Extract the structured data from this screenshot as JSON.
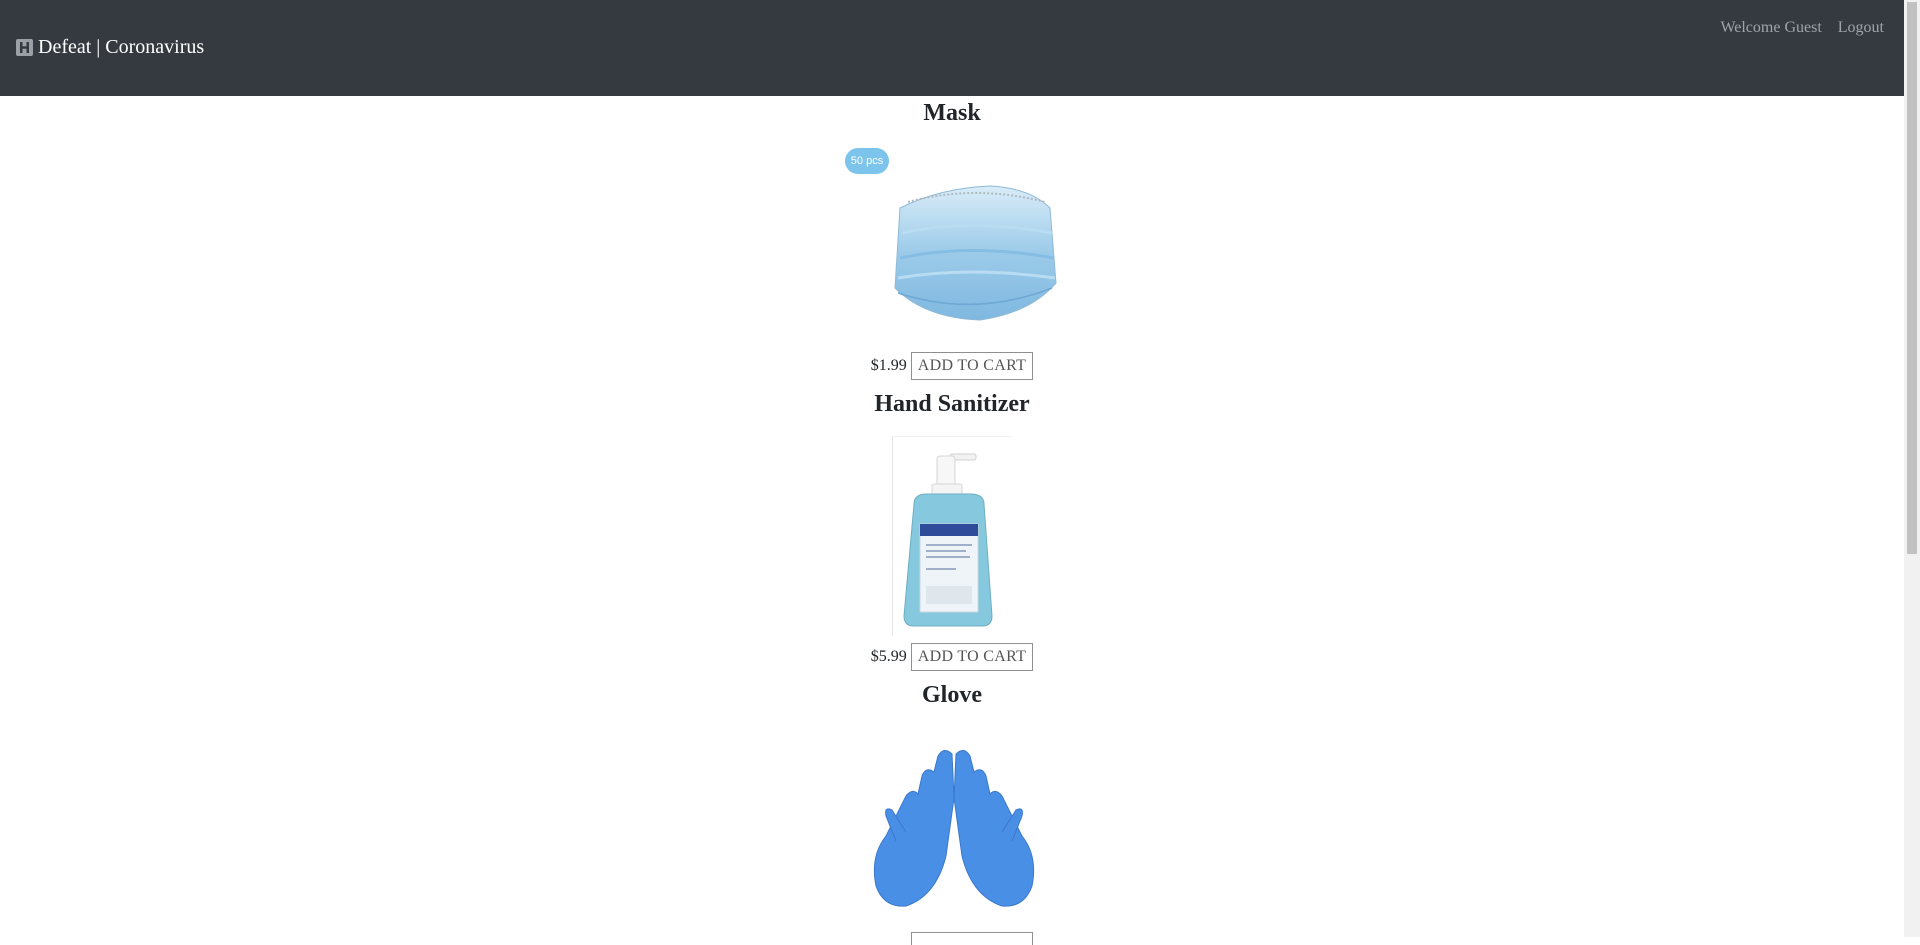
{
  "navbar": {
    "brand_icon": "hospital-icon",
    "brand_label": "Defeat | Coronavirus",
    "welcome_text": "Welcome Guest",
    "logout_label": "Logout"
  },
  "products": [
    {
      "name": "Mask",
      "badge": "50 pcs",
      "image": "surgical-mask-image",
      "price": "$1.99",
      "button_label": "ADD TO CART"
    },
    {
      "name": "Hand Sanitizer",
      "image": "hand-sanitizer-bottle-image",
      "price": "$5.99",
      "button_label": "ADD TO CART"
    },
    {
      "name": "Glove",
      "image": "blue-nitrile-gloves-image"
    }
  ],
  "colors": {
    "navbar_bg": "#343a40",
    "badge_bg": "#7cc4ec",
    "mask_blue": "#a8d4f0",
    "sanitizer_blue": "#7ec3d8",
    "glove_blue": "#4a90e8"
  }
}
